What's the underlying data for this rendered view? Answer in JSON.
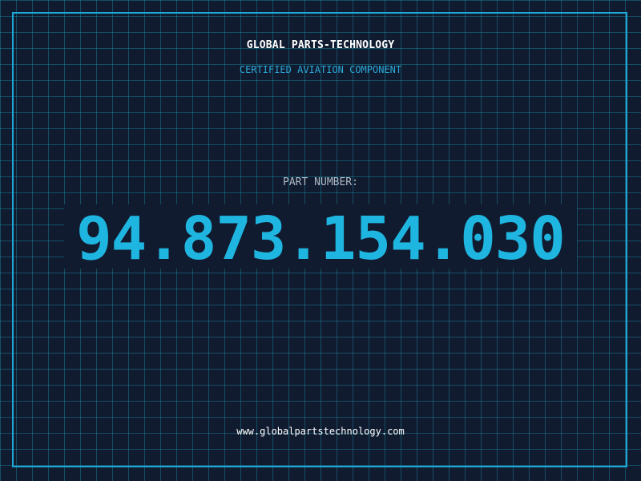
{
  "header": {
    "company": "GLOBAL PARTS-TECHNOLOGY",
    "subtitle": "CERTIFIED AVIATION COMPONENT"
  },
  "part": {
    "label": "PART NUMBER:",
    "number": "94.873.154.030"
  },
  "footer": {
    "website": "www.globalpartstechnology.com"
  },
  "colors": {
    "background": "#111b30",
    "grid": "#188ca0",
    "frame": "#1fa7d6",
    "accent": "#1eb6e0",
    "subtitle": "#2aa8d8",
    "label": "#aeb8c4",
    "text": "#ffffff"
  }
}
